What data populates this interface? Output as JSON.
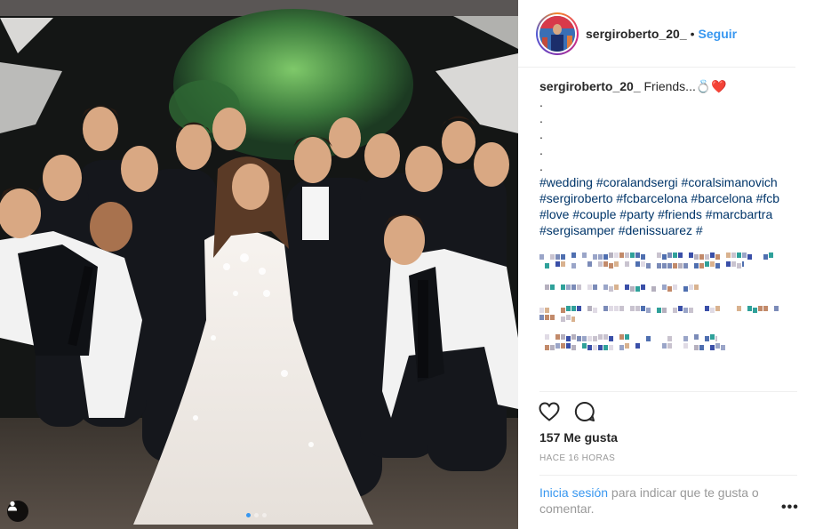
{
  "post": {
    "username": "sergiroberto_20_",
    "separator": "•",
    "follow_label": "Seguir"
  },
  "caption": {
    "username": "sergiroberto_20_",
    "text": "Friends...💍❤️",
    "dot_lines": [
      ".",
      ".",
      ".",
      ".",
      "."
    ],
    "hashtags": "#wedding #coralandsergi #coralsimanovich #sergiroberto #fcbarcelona #barcelona #fcb #love #couple #party #friends #marcbartra #sergisamper #denissuarez #"
  },
  "stats": {
    "likes": "157 Me gusta",
    "time": "HACE 16 HORAS"
  },
  "login": {
    "link": "Inicia sesión",
    "text": " para indicar que te gusta o comentar."
  },
  "more_label": "•••",
  "icons": {
    "tag": "person-tag-icon",
    "like": "heart-icon",
    "comment": "comment-icon",
    "more": "more-options-icon"
  },
  "colors": {
    "accent": "#3897f0",
    "hashtag": "#003569",
    "muted": "#999999"
  },
  "carousel": {
    "count": 3,
    "active": 0
  }
}
